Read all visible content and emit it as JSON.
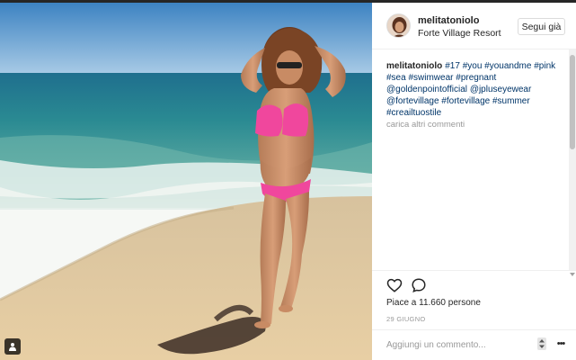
{
  "post": {
    "username": "melitatoniolo",
    "location": "Forte Village Resort",
    "follow_label": "Segui già",
    "caption": {
      "author": "melitatoniolo",
      "text_parts": [
        {
          "t": "#17",
          "tag": true
        },
        {
          "t": " ",
          "tag": false
        },
        {
          "t": "#you",
          "tag": true
        },
        {
          "t": " ",
          "tag": false
        },
        {
          "t": "#youandme",
          "tag": true
        },
        {
          "t": " ",
          "tag": false
        },
        {
          "t": "#pink",
          "tag": true
        },
        {
          "t": " ",
          "tag": false
        },
        {
          "t": "#sea",
          "tag": true
        },
        {
          "t": " ",
          "tag": false
        },
        {
          "t": "#swimwear",
          "tag": true
        },
        {
          "t": " ",
          "tag": false
        },
        {
          "t": "#pregnant",
          "tag": true
        },
        {
          "t": " ",
          "tag": false
        },
        {
          "t": "@goldenpointofficial",
          "tag": true
        },
        {
          "t": " ",
          "tag": false
        },
        {
          "t": "@jpluseyewear",
          "tag": true
        },
        {
          "t": " ",
          "tag": false
        },
        {
          "t": "@fortevillage",
          "tag": true
        },
        {
          "t": " ",
          "tag": false
        },
        {
          "t": "#fortevillage",
          "tag": true
        },
        {
          "t": " ",
          "tag": false
        },
        {
          "t": "#summer",
          "tag": true
        },
        {
          "t": " ",
          "tag": false
        },
        {
          "t": "#creailtuostile",
          "tag": true
        }
      ]
    },
    "more_comments": "carica altri commenti",
    "likes": "Piace a 11.660 persone",
    "date": "29 GIUGNO",
    "comment_placeholder": "Aggiungi un commento...",
    "more_options": "•••"
  },
  "icons": {
    "like": "heart-icon",
    "comment": "comment-bubble-icon",
    "user_tag": "user-tag-icon",
    "stepper": "stepper-arrows-icon",
    "more": "ellipsis-icon"
  },
  "colors": {
    "sky": "#4d8fc9",
    "sea": "#2f8e93",
    "sand": "#e3c9a0",
    "bikini": "#f0479d",
    "link": "#003569"
  }
}
